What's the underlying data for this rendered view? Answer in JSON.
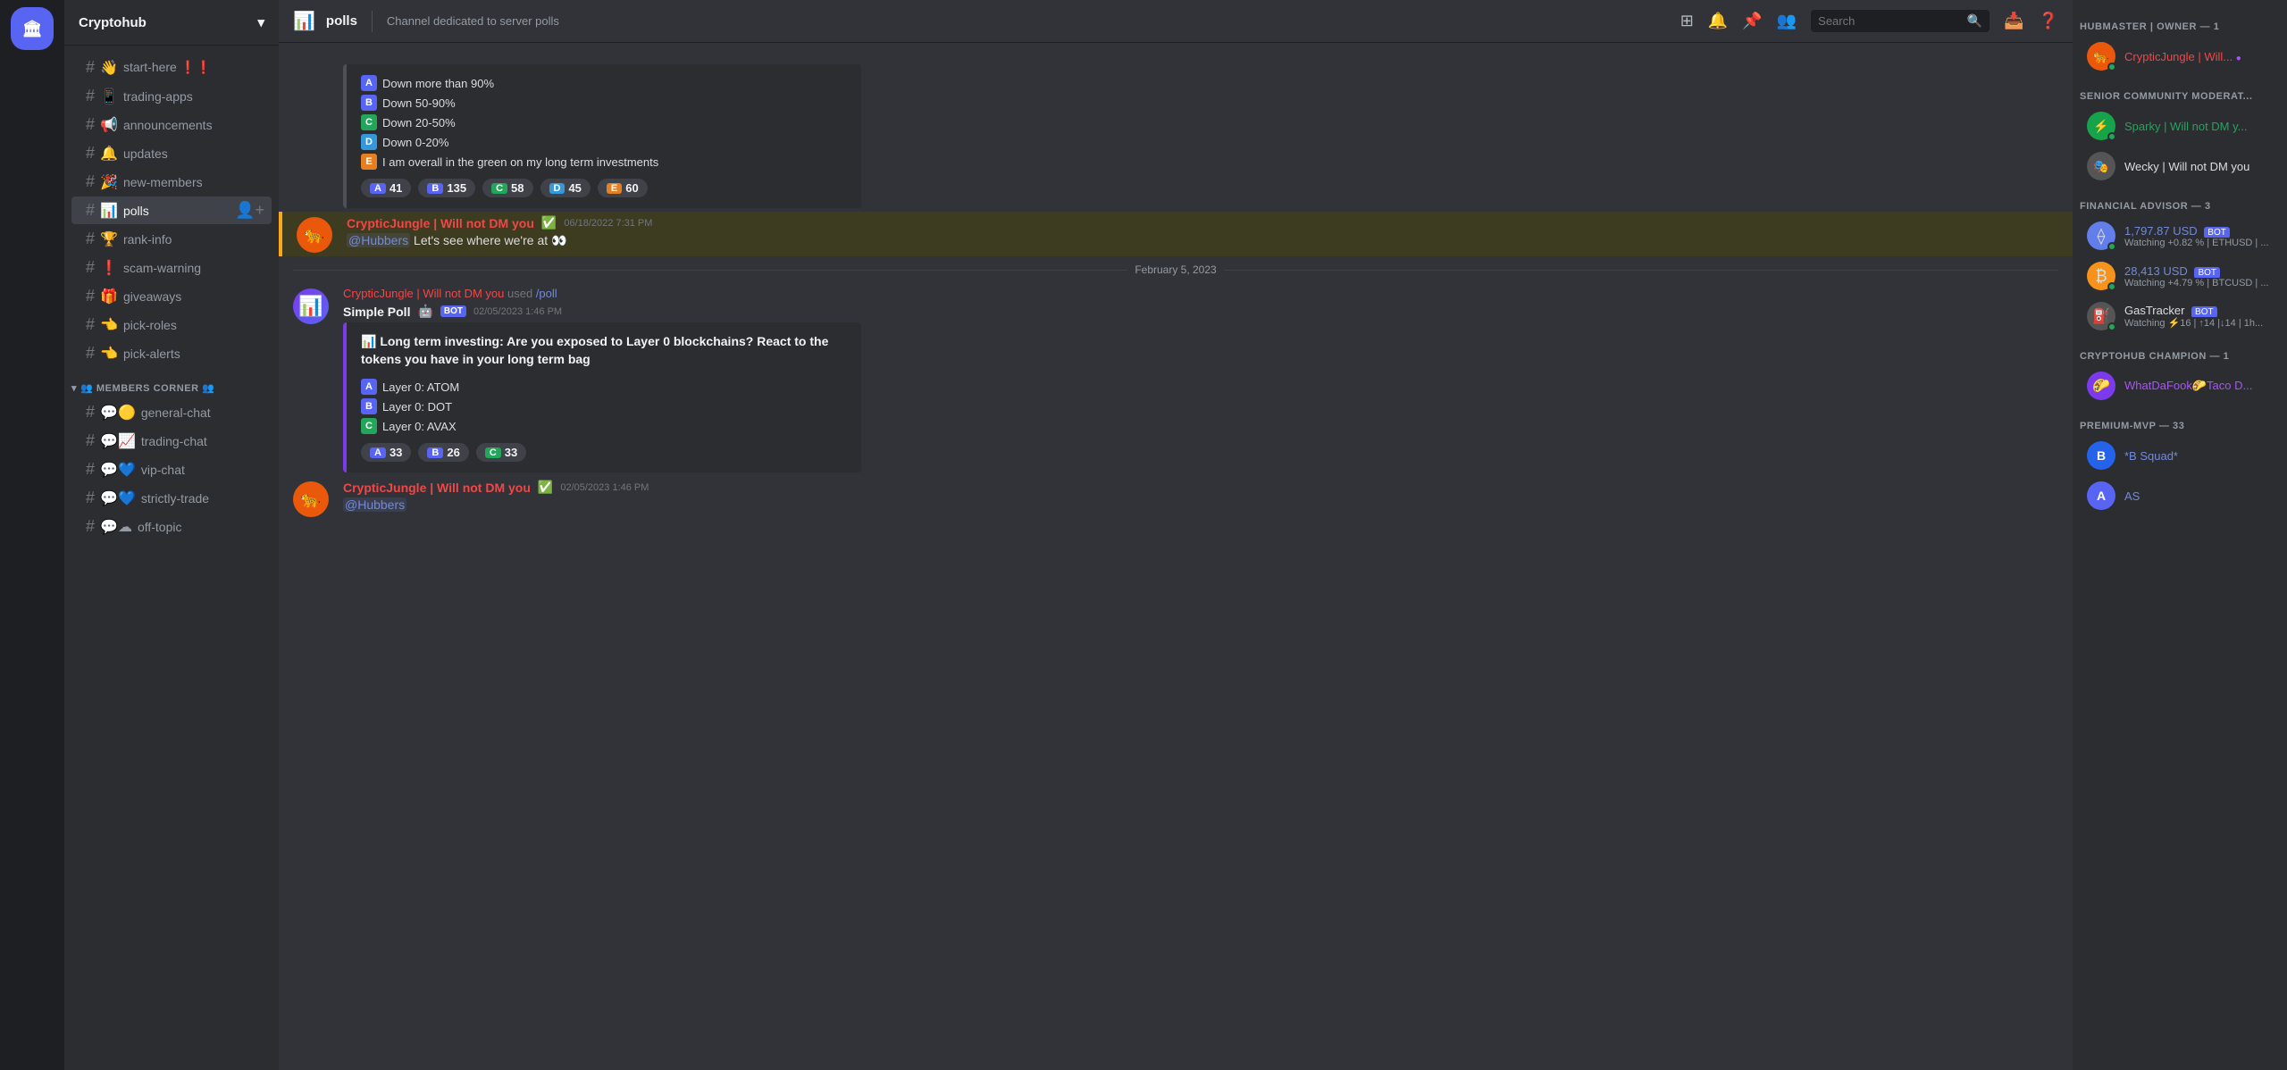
{
  "server": {
    "name": "Cryptohub",
    "icon": "🏛"
  },
  "header": {
    "channel_icon": "📊",
    "channel_name": "polls",
    "channel_description": "Channel dedicated to server polls",
    "search_placeholder": "Search"
  },
  "channels": [
    {
      "id": "start-here",
      "name": "start-here",
      "icon": "👋",
      "suffix": "❗❗",
      "hasIcon": true
    },
    {
      "id": "trading-apps",
      "name": "trading-apps",
      "icon": "📱",
      "hasIcon": true
    },
    {
      "id": "announcements",
      "name": "announcements",
      "icon": "📢",
      "hasIcon": true
    },
    {
      "id": "updates",
      "name": "updates",
      "icon": "🔔",
      "hasIcon": true
    },
    {
      "id": "new-members",
      "name": "new-members",
      "icon": "🎉",
      "hasIcon": true
    },
    {
      "id": "polls",
      "name": "polls",
      "icon": "📊",
      "active": true,
      "hasIcon": true
    },
    {
      "id": "rank-info",
      "name": "rank-info",
      "icon": "🏆",
      "hasIcon": true
    },
    {
      "id": "scam-warning",
      "name": "scam-warning",
      "icon": "❗",
      "hasIcon": true
    },
    {
      "id": "giveaways",
      "name": "giveaways",
      "icon": "🎁",
      "hasIcon": true
    },
    {
      "id": "pick-roles",
      "name": "pick-roles",
      "icon": "👈",
      "hasIcon": true
    },
    {
      "id": "pick-alerts",
      "name": "pick-alerts",
      "icon": "👈",
      "hasIcon": true
    }
  ],
  "category_members": "MEMBERS CORNER",
  "member_channels": [
    {
      "id": "general-chat",
      "name": "general-chat",
      "icon": "💬🟡"
    },
    {
      "id": "trading-chat",
      "name": "trading-chat",
      "icon": "💬📈"
    },
    {
      "id": "vip-chat",
      "name": "vip-chat",
      "icon": "💬💙"
    },
    {
      "id": "strictly-trade",
      "name": "strictly-trade",
      "icon": "💬💙"
    },
    {
      "id": "off-topic",
      "name": "off-topic",
      "icon": "💬☁"
    }
  ],
  "messages": [
    {
      "id": "poll1",
      "type": "poll_options",
      "options": [
        {
          "letter": "A",
          "text": "Down more than 90%"
        },
        {
          "letter": "B",
          "text": "Down 50-90%"
        },
        {
          "letter": "C",
          "text": "Down 20-50%"
        },
        {
          "letter": "D",
          "text": "Down 0-20%"
        },
        {
          "letter": "E",
          "text": "I am overall in the green on my long term investments"
        }
      ],
      "votes": [
        {
          "letter": "A",
          "count": "41"
        },
        {
          "letter": "B",
          "count": "135"
        },
        {
          "letter": "C",
          "count": "58"
        },
        {
          "letter": "D",
          "count": "45"
        },
        {
          "letter": "E",
          "count": "60"
        }
      ]
    },
    {
      "id": "msg1",
      "type": "user_message",
      "highlight": true,
      "author": "CrypticJungle | Will not DM you",
      "author_color": "red",
      "timestamp": "06/18/2022 7:31 PM",
      "verified": true,
      "text": "@Hubbers Let's see where we're at 👀"
    },
    {
      "id": "date1",
      "type": "date_divider",
      "date": "February 5, 2023"
    },
    {
      "id": "msg2",
      "type": "poll_message",
      "used_by": "CrypticJungle | Will not DM you",
      "command": "/poll",
      "bot_name": "Simple Poll",
      "bot_timestamp": "02/05/2023 1:46 PM",
      "poll_title": "📊 Long term investing: Are you exposed to Layer 0 blockchains? React to the tokens you have in your long term bag",
      "poll_options": [
        {
          "letter": "A",
          "text": "Layer 0: ATOM"
        },
        {
          "letter": "B",
          "text": "Layer 0: DOT"
        },
        {
          "letter": "C",
          "text": "Layer 0: AVAX"
        }
      ],
      "votes": [
        {
          "letter": "A",
          "count": "33"
        },
        {
          "letter": "B",
          "count": "26"
        },
        {
          "letter": "C",
          "count": "33"
        }
      ]
    },
    {
      "id": "msg3",
      "type": "user_message",
      "author": "CrypticJungle | Will not DM you",
      "author_color": "red",
      "timestamp": "02/05/2023 1:46 PM",
      "verified": true,
      "text": "@Hubbers"
    }
  ],
  "right_sidebar": {
    "categories": [
      {
        "name": "HUBMASTER | OWNER — 1",
        "members": [
          {
            "name": "CrypticJungle | Will...",
            "color": "red",
            "avatar_color": "#ea580c",
            "avatar_text": "🐆",
            "status": ""
          }
        ]
      },
      {
        "name": "SENIOR COMMUNITY MODERAT...",
        "members": [
          {
            "name": "Sparky | Will not DM y...",
            "color": "green",
            "avatar_color": "#16a34a",
            "avatar_text": "⚡",
            "status": ""
          },
          {
            "name": "Wecky | Will not DM you",
            "color": "white",
            "avatar_color": "#555",
            "avatar_text": "🎭",
            "status": ""
          }
        ]
      },
      {
        "name": "FINANCIAL ADVISOR — 3",
        "members": [
          {
            "name": "1,797.87 USD",
            "color": "blue",
            "avatar_color": "#627eea",
            "avatar_text": "⟠",
            "status": "Watching +0.82 % | ETHUSD | ...",
            "bot": true
          },
          {
            "name": "28,413 USD",
            "color": "blue",
            "avatar_color": "#f7931a",
            "avatar_text": "₿",
            "status": "Watching +4.79 % | BTCUSD | ...",
            "bot": true
          },
          {
            "name": "GasTracker",
            "color": "white",
            "avatar_color": "#555",
            "avatar_text": "⛽",
            "status": "Watching ⚡16 | ↑14 |↓14 | 1h...",
            "bot": true
          }
        ]
      },
      {
        "name": "CRYPTOHUB CHAMPION — 1",
        "members": [
          {
            "name": "WhatDaFook🌮Taco D...",
            "color": "purple",
            "avatar_color": "#7c3aed",
            "avatar_text": "🌮",
            "status": ""
          }
        ]
      },
      {
        "name": "PREMIUM-MVP — 33",
        "members": [
          {
            "name": "*B Squad*",
            "color": "blue",
            "avatar_color": "#2563eb",
            "avatar_text": "B",
            "status": ""
          },
          {
            "name": "AS",
            "color": "blue",
            "avatar_color": "#5865f2",
            "avatar_text": "A",
            "status": ""
          }
        ]
      }
    ]
  }
}
